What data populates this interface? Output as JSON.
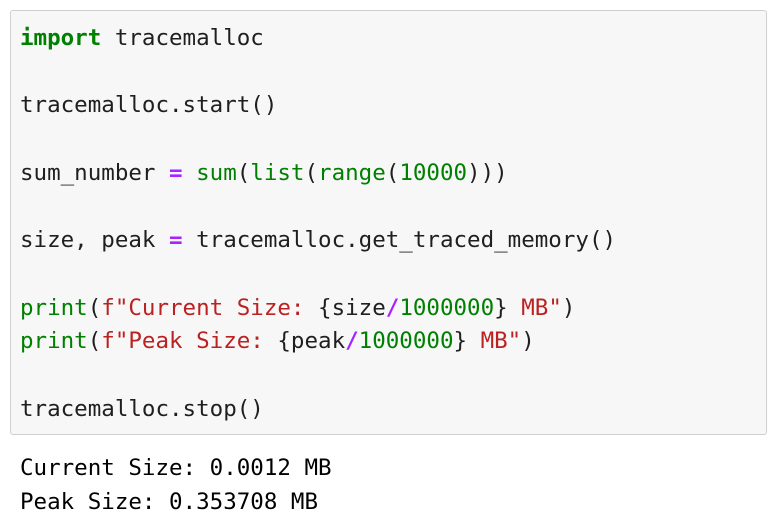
{
  "code_cell": {
    "lines": [
      {
        "parts": [
          {
            "kind": "kw",
            "text": "import"
          },
          {
            "kind": "plain",
            "text": " tracemalloc"
          }
        ]
      },
      {
        "parts": []
      },
      {
        "parts": [
          {
            "kind": "plain",
            "text": "tracemalloc.start()"
          }
        ]
      },
      {
        "parts": []
      },
      {
        "parts": [
          {
            "kind": "plain",
            "text": "sum_number "
          },
          {
            "kind": "op",
            "text": "="
          },
          {
            "kind": "plain",
            "text": " "
          },
          {
            "kind": "bi",
            "text": "sum"
          },
          {
            "kind": "plain",
            "text": "("
          },
          {
            "kind": "bi",
            "text": "list"
          },
          {
            "kind": "plain",
            "text": "("
          },
          {
            "kind": "bi",
            "text": "range"
          },
          {
            "kind": "plain",
            "text": "("
          },
          {
            "kind": "num",
            "text": "10000"
          },
          {
            "kind": "plain",
            "text": ")))"
          }
        ]
      },
      {
        "parts": []
      },
      {
        "parts": [
          {
            "kind": "plain",
            "text": "size, peak "
          },
          {
            "kind": "op",
            "text": "="
          },
          {
            "kind": "plain",
            "text": " tracemalloc.get_traced_memory()"
          }
        ]
      },
      {
        "parts": []
      },
      {
        "parts": [
          {
            "kind": "bi",
            "text": "print"
          },
          {
            "kind": "plain",
            "text": "("
          },
          {
            "kind": "str",
            "text": "f\"Current Size: "
          },
          {
            "kind": "plain",
            "text": "{size"
          },
          {
            "kind": "op",
            "text": "/"
          },
          {
            "kind": "num",
            "text": "1000000"
          },
          {
            "kind": "plain",
            "text": "}"
          },
          {
            "kind": "str",
            "text": " MB\""
          },
          {
            "kind": "plain",
            "text": ")"
          }
        ]
      },
      {
        "parts": [
          {
            "kind": "bi",
            "text": "print"
          },
          {
            "kind": "plain",
            "text": "("
          },
          {
            "kind": "str",
            "text": "f\"Peak Size: "
          },
          {
            "kind": "plain",
            "text": "{peak"
          },
          {
            "kind": "op",
            "text": "/"
          },
          {
            "kind": "num",
            "text": "1000000"
          },
          {
            "kind": "plain",
            "text": "}"
          },
          {
            "kind": "str",
            "text": " MB\""
          },
          {
            "kind": "plain",
            "text": ")"
          }
        ]
      },
      {
        "parts": []
      },
      {
        "parts": [
          {
            "kind": "plain",
            "text": "tracemalloc.stop()"
          }
        ]
      }
    ]
  },
  "output": {
    "lines": [
      "Current Size: 0.0012 MB",
      "Peak Size: 0.353708 MB"
    ]
  },
  "colors": {
    "keyword": "#008000",
    "builtin": "#008000",
    "number": "#008000",
    "operator": "#aa22ff",
    "string": "#ba2121",
    "text": "#1f1f1f",
    "cell_background": "#f7f7f7",
    "cell_border": "#cfcfcf"
  }
}
